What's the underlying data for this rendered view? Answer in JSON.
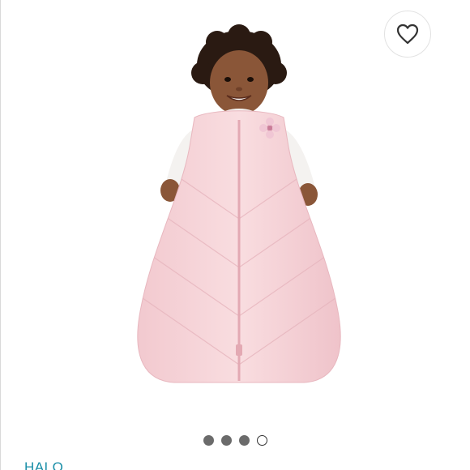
{
  "product": {
    "image_name": "baby-in-pink-sleep-sack-photo",
    "brand": "HALO"
  },
  "like_button": {
    "icon": "heart-outline-icon"
  },
  "carousel": {
    "total_images": 4,
    "active_index": 3
  },
  "colors": {
    "brand_link": "#1b8fa8",
    "dot_inactive": "#6b6b6b",
    "sleep_sack": "#f7d6da"
  }
}
